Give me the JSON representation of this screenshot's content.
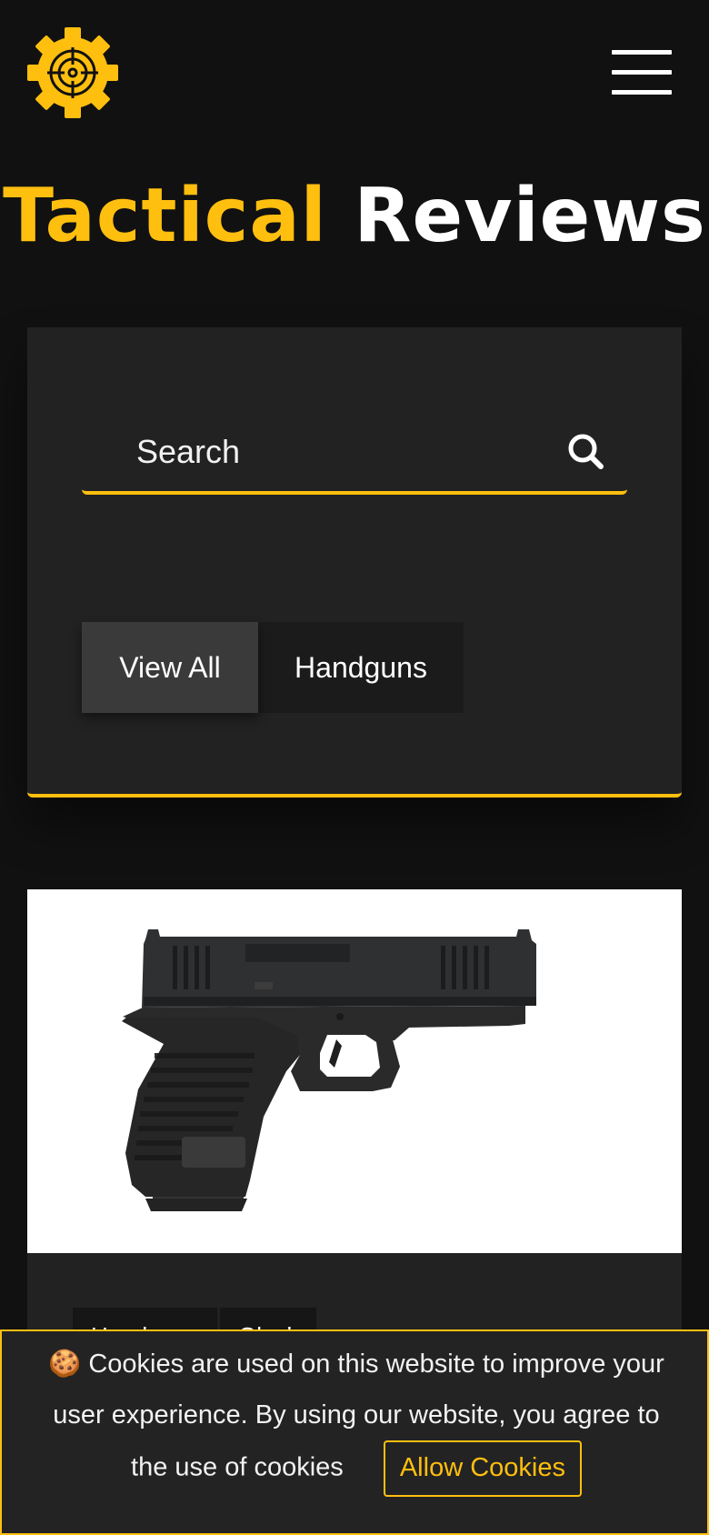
{
  "brand": {
    "title_part1": "Tactical",
    "title_part2": "Reviews",
    "accent_color": "#ffbf0f",
    "logo_icon": "gear-target-icon"
  },
  "header": {
    "menu_icon": "hamburger-menu-icon"
  },
  "search": {
    "placeholder": "Search",
    "icon": "search-icon"
  },
  "filters": [
    {
      "label": "View All",
      "active": true
    },
    {
      "label": "Handguns",
      "active": false
    }
  ],
  "card": {
    "image_alt": "handgun-image",
    "tags": [
      "Handguns",
      "Glock"
    ]
  },
  "cookie_banner": {
    "emoji": "🍪",
    "text": "Cookies are used on this website to improve your user experience. By using our website, you agree to the use of cookies",
    "button_label": "Allow Cookies"
  }
}
